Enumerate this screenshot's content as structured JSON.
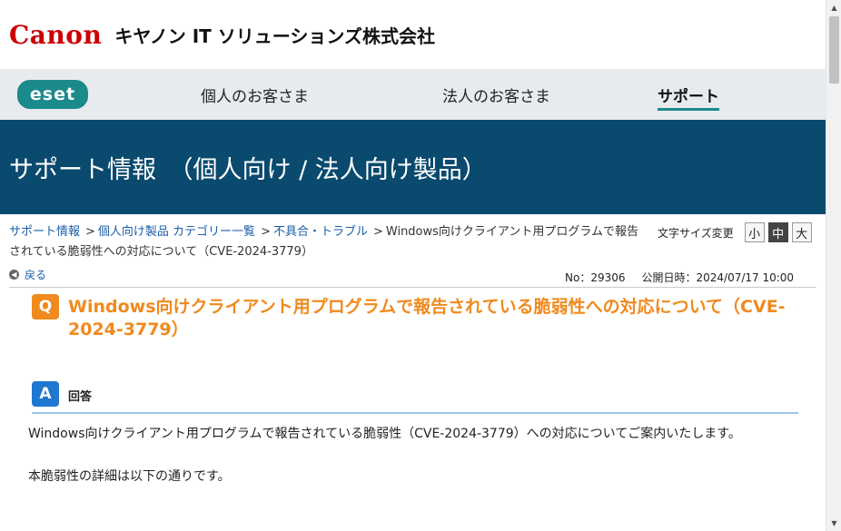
{
  "header": {
    "brand": "Canon",
    "company": "キヤノン IT ソリューションズ株式会社"
  },
  "nav": {
    "logo": "eset",
    "items": [
      {
        "label": "個人のお客さま"
      },
      {
        "label": "法人のお客さま"
      },
      {
        "label": "サポート"
      }
    ]
  },
  "hero": {
    "title": "サポート情報　（個人向け / 法人向け製品）"
  },
  "breadcrumb": {
    "items": [
      {
        "label": "サポート情報"
      },
      {
        "label": "個人向け製品 カテゴリー一覧"
      },
      {
        "label": "不具合・トラブル"
      }
    ],
    "current": "Windows向けクライアント用プログラムで報告されている脆弱性への対応について（CVE-2024-3779）",
    "separator": ">"
  },
  "font_size": {
    "label": "文字サイズ変更",
    "options": [
      "小",
      "中",
      "大"
    ],
    "selected": "中"
  },
  "meta": {
    "back": "戻る",
    "number": "No：29306",
    "published": "公開日時：2024/07/17 10:00"
  },
  "question": {
    "badge": "Q",
    "title": "Windows向けクライアント用プログラムで報告されている脆弱性への対応について（CVE-2024-3779）"
  },
  "answer": {
    "badge": "A",
    "label": "回答",
    "paragraphs": [
      "Windows向けクライアント用プログラムで報告されている脆弱性（CVE-2024-3779）への対応についてご案内いたします。",
      "本脆弱性の詳細は以下の通りです。"
    ]
  },
  "colors": {
    "brand_red": "#cc0000",
    "hero_blue": "#0a4a6e",
    "eset_teal": "#1b8a8a",
    "question_orange": "#f08a1e",
    "answer_blue": "#1f77d0",
    "link": "#1a5ea8"
  }
}
